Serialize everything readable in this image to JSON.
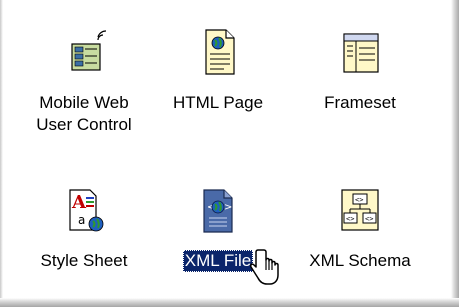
{
  "items": [
    {
      "label_line1": "Mobile Web",
      "label_line2": "User Control",
      "icon": "mobile-web-user-control-icon"
    },
    {
      "label": "HTML Page",
      "icon": "html-page-icon"
    },
    {
      "label": "Frameset",
      "icon": "frameset-icon"
    },
    {
      "label": "Style Sheet",
      "icon": "style-sheet-icon"
    },
    {
      "label": "XML File",
      "icon": "xml-file-icon",
      "selected": true
    },
    {
      "label": "XML Schema",
      "icon": "xml-schema-icon"
    }
  ],
  "colors": {
    "selection": "#0a246a",
    "selection_text": "#ffffff"
  }
}
